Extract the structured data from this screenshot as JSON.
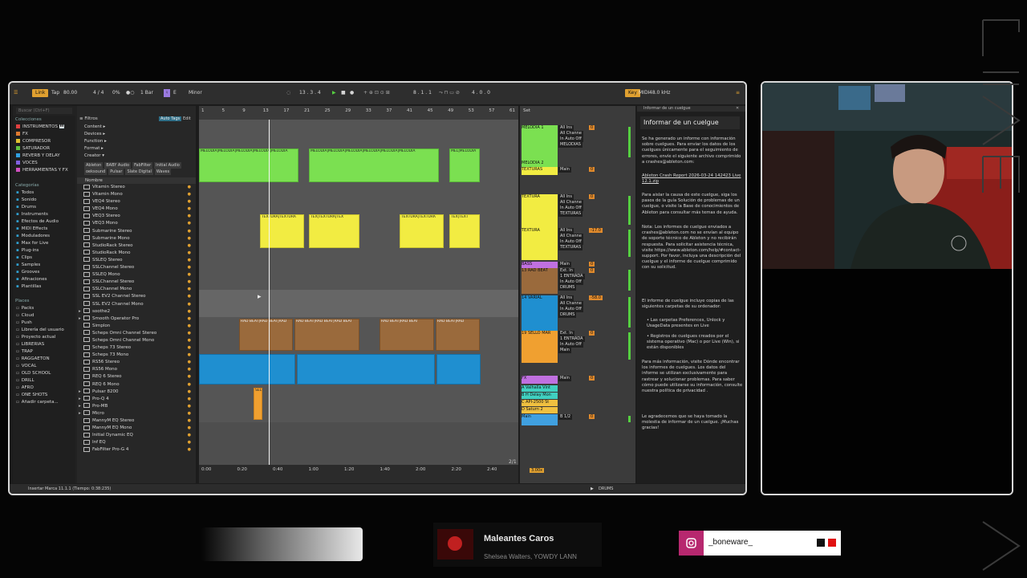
{
  "transport": {
    "link": "Link",
    "tap": "Tap",
    "tempo": "80.00",
    "sig": "4 / 4",
    "pct": "0%",
    "quant": "1 Bar",
    "key": "E",
    "scale": "Minor",
    "position": "13 . 3 . 4",
    "loop_start": "8 . 1 . 1",
    "loop_len": "4 . 0 . 0",
    "key_btn": "Key",
    "midi": "MIDI",
    "sr": "48.0 kHz"
  },
  "browser": {
    "search_placeholder": "Buscar (Ctrl+F)",
    "collections_title": "Colecciones",
    "collections": [
      {
        "label": "INSTRUMENTOS 🎹",
        "color": "#e04040"
      },
      {
        "label": "FX",
        "color": "#e07a30"
      },
      {
        "label": "COMPRESOR",
        "color": "#e0c030"
      },
      {
        "label": "SATURADOR",
        "color": "#60c040"
      },
      {
        "label": "REVERB Y DELAY",
        "color": "#30a0e0"
      },
      {
        "label": "VOCES",
        "color": "#8060e0"
      },
      {
        "label": "HERRAMIENTAS Y FX",
        "color": "#d050c0"
      }
    ],
    "categories_title": "Categorías",
    "categories": [
      "Todos",
      "Sonido",
      "Drums",
      "Instruments",
      "Efectos de Audio",
      "MIDI Effects",
      "Moduladores",
      "Max for Live",
      "Plug-ins",
      "Clips",
      "Samples",
      "Grooves",
      "Afinaciones",
      "Plantillas"
    ],
    "places_title": "Places",
    "places": [
      "Packs",
      "Cloud",
      "Push",
      "Librería del usuario",
      "Proyecto actual",
      "LIBRERIAS",
      "TRAP",
      "RAGGAETON",
      "VOCAL",
      "OLD SCHOOL",
      "DRILL",
      "AFRO",
      "ONE SHOTS",
      "Añadir carpeta..."
    ],
    "filters_label": "Filtros",
    "auto_tags": "Auto Tags",
    "edit": "Edit",
    "filter_rows": [
      "Content ▸",
      "Devices ▸",
      "Function ▸",
      "Format ▸",
      "Creator ▾"
    ],
    "tags": [
      "Ableton",
      "BABY Audio",
      "FabFilter",
      "Initial Audio",
      "oeksound",
      "Pulsar",
      "Slate Digital",
      "Waves"
    ],
    "name_header": "Nombre",
    "files": [
      "Vitamin Stereo",
      "Vitamin Mono",
      "VEQ4 Stereo",
      "VEQ4 Mono",
      "VEQ3 Stereo",
      "VEQ3 Mono",
      "Submarine Stereo",
      "Submarine Mono",
      "StudioRack Stereo",
      "StudioRack Mono",
      "SSLEQ Stereo",
      "SSLChannel Stereo",
      "SSLEQ Mono",
      "SSLChannel Stereo",
      "SSLChannel Mono",
      "SSL EV2 Channel Stereo",
      "SSL EV2 Channel Mono",
      "soothe2",
      "Smooth Operator Pro",
      "Simplon",
      "Scheps Omni Channel Stereo",
      "Scheps Omni Channel Mono",
      "Scheps 73 Stereo",
      "Scheps 73 Mono",
      "RS56 Stereo",
      "RS56 Mono",
      "REQ 6 Stereo",
      "REQ 6 Mono",
      "Pulsar 8200",
      "Pro-Q 4",
      "Pro-MB",
      "Micro",
      "MannyM EQ Stereo",
      "MannyM EQ Mono",
      "Initial Dynamic EQ",
      "Inf EQ",
      "FabFilter Pro-G 4"
    ]
  },
  "ruler": [
    "1",
    "5",
    "9",
    "13",
    "17",
    "21",
    "25",
    "29",
    "33",
    "37",
    "41",
    "45",
    "49",
    "53",
    "57",
    "61"
  ],
  "timeline": [
    "0:00",
    "0:20",
    "0:40",
    "1:00",
    "1:20",
    "1:40",
    "2:00",
    "2:20",
    "2:40"
  ],
  "clips": {
    "melodia": "MELODIA",
    "textura": "TEXTURA",
    "beat": "RAD BEAT",
    "sello": "SELL"
  },
  "tracks": [
    {
      "name": "MELODIA 1",
      "color": "#7be051",
      "io": [
        "All Ins",
        "All Channe",
        "In Auto Off",
        "MELODIAS"
      ],
      "vol": "0"
    },
    {
      "name": "MELODIA 2",
      "color": "#7be051",
      "io": [],
      "vol": ""
    },
    {
      "name": "TEXTURAS",
      "color": "#f2ec42",
      "io": [
        "Main"
      ],
      "vol": "0"
    },
    {
      "name": "TEXTURA",
      "color": "#f2ec42",
      "io": [
        "All Ins",
        "All Channe",
        "In Auto Off",
        "TEXTURAS"
      ],
      "vol": "0"
    },
    {
      "name": "TEXTURA",
      "color": "#f2ec42",
      "io": [
        "All Ins",
        "All Channe",
        "In Auto Off",
        "TEXTURAS"
      ],
      "vol": "-17.0"
    },
    {
      "name": "BASS",
      "color": "#c070e0",
      "io": [
        "Main"
      ],
      "vol": "0"
    },
    {
      "name": "13 RAD BEAT",
      "color": "#9a6a3c",
      "io": [
        "Ext. In",
        "1 ENTRADA",
        "In Auto Off",
        "DRUMS"
      ],
      "vol": "0"
    },
    {
      "name": "14 VARIAL",
      "color": "#1f8fd0",
      "io": [
        "All Ins",
        "All Channe",
        "In Auto Off",
        "DRUMS"
      ],
      "vol": "-58.0"
    },
    {
      "name": "19 SELLO MAR",
      "color": "#f0a030",
      "io": [
        "Ext. In",
        "1 ENTRADA",
        "In Auto Off",
        "Main"
      ],
      "vol": "0"
    },
    {
      "name": "FX",
      "color": "#c070e0",
      "io": [
        "Main"
      ],
      "vol": "0"
    },
    {
      "name": "A Valhalla Vint",
      "color": "#40d0c0",
      "io": [],
      "vol": ""
    },
    {
      "name": "B H Delay Mon",
      "color": "#40d0c0",
      "io": [],
      "vol": ""
    },
    {
      "name": "C API-2500 St",
      "color": "#f0c040",
      "io": [],
      "vol": ""
    },
    {
      "name": "D Saturn 2",
      "color": "#f0c040",
      "io": [],
      "vol": ""
    },
    {
      "name": "Main",
      "color": "#40a0e0",
      "io": [
        "B 1/2"
      ],
      "vol": "0"
    }
  ],
  "session": {
    "set": "Set",
    "page": "2/1",
    "tempo_small": "3.00x"
  },
  "help": {
    "header": "Informar de un cuelgue",
    "title": "Informar de un cuelgue",
    "paragraphs": [
      "Se ha generado un informe con información sobre cuelgues. Para enviar los datos de los cuelgues únicamente para el seguimiento de errores, envíe el siguiente archivo comprimido a crashes@ableton.com:",
      "Ableton Crash Report 2026-03-24 142423 Live 12.1.zip",
      "Para aislar la causa de este cuelgue, siga los pasos de la guía Solución de problemas de un cuelgue, o visite la Base de conocimientos de Ableton para consultar más temas de ayuda.",
      "Nota: Los informes de cuelgue enviados a crashes@ableton.com no se envían al equipo de soporte técnico de Ableton y no recibirán respuesta. Para solicitar asistencia técnica, visite https://www.ableton.com/help/#contact-support. Por favor, incluya una descripción del cuelgue y el informe de cuelgue comprimido con su solicitud.",
      "El informe de cuelgue incluye copias de las siguientes carpetas de su ordenador:",
      "• Las carpetas Preferences, Unlock y UsageData presentes en Live",
      "• Registros de cuelgues creados por el sistema operativo (Mac) o por Live (Win), si están disponibles",
      "Para más información, visite Dónde encontrar los informes de cuelgues. Los datos del informe se utilizan exclusivamente para rastrear y solucionar problemas. Para saber cómo puede utilizarse su información, consulte nuestra política de privacidad .",
      "Le agradecemos que se haya tomado la molestia de informar de un cuelgue. ¡Muchas gracias!"
    ]
  },
  "status": {
    "left": "Insertar Marca 11.1.1 (Tiempo: 0:38:235)",
    "right": "DRUMS"
  },
  "now_playing": {
    "title": "Maleantes Caros",
    "subtitle": "Shelsea Walters, YOWDY LANN"
  },
  "social": {
    "handle": "_boneware_"
  },
  "colors": {
    "accent": "#e0a030",
    "green": "#7be051",
    "yellow": "#f2ec42",
    "blue": "#1f8fd0",
    "brown": "#9a6a3c",
    "instagram": "#b7286f"
  }
}
